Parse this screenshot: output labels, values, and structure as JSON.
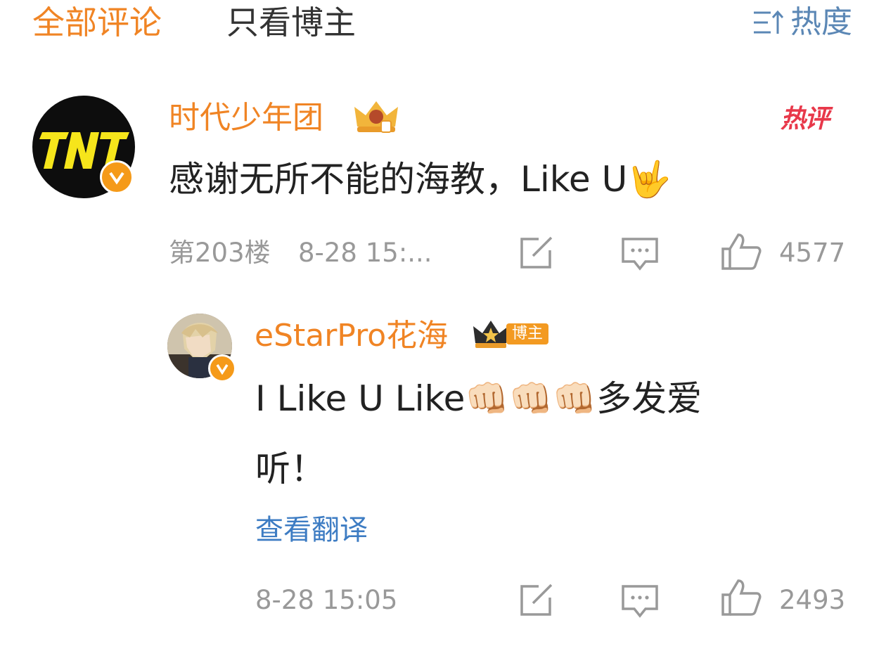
{
  "tabs": {
    "all_comments": "全部评论",
    "owner_only": "只看博主"
  },
  "sort": {
    "label": "热度",
    "icon": "sort-icon"
  },
  "comments": [
    {
      "username": "时代少年团",
      "avatar_text": "TNT",
      "hot_badge": "热评",
      "text": "感谢无所不能的海教，Like U🤟",
      "floor": "第203楼",
      "time": "8-28 15:...",
      "likes": "4577",
      "icons": [
        "share-icon",
        "comment-icon",
        "like-icon"
      ]
    },
    {
      "username": "eStarPro花海",
      "owner_tag": "博主",
      "text_line1": "I Like U Like👊🏻👊🏻👊🏻多发爱",
      "text_line2": "听！",
      "translate_link": "查看翻译",
      "time": "8-28 15:05",
      "likes": "2493",
      "icons": [
        "share-icon",
        "comment-icon",
        "like-icon"
      ]
    }
  ],
  "colors": {
    "accent_orange": "#f08424",
    "link_blue": "#3d7cc3",
    "sort_blue": "#5b87b5",
    "hot_red": "#e8384a",
    "meta_gray": "#999999"
  }
}
